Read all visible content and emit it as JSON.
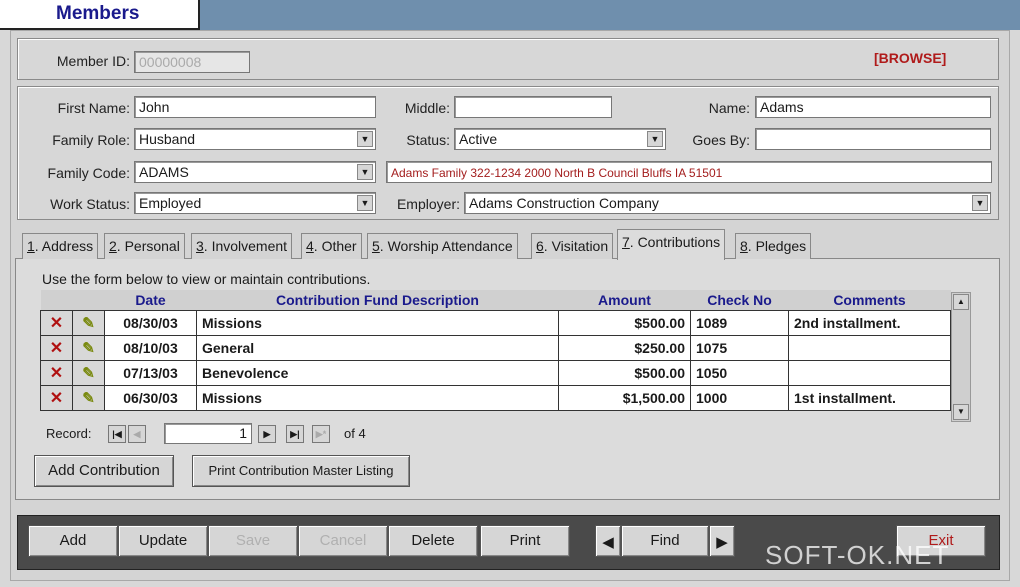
{
  "window": {
    "title": "Members"
  },
  "header": {
    "member_id_label": "Member ID:",
    "member_id_value": "00000008",
    "mode": "[BROWSE]"
  },
  "form": {
    "first_name_label": "First Name:",
    "first_name": "John",
    "middle_label": "Middle:",
    "middle": "",
    "name_label": "Name:",
    "name": "Adams",
    "family_role_label": "Family Role:",
    "family_role": "Husband",
    "status_label": "Status:",
    "status": "Active",
    "goes_by_label": "Goes By:",
    "goes_by": "",
    "family_code_label": "Family Code:",
    "family_code": "ADAMS",
    "family_info": "Adams Family 322-1234 2000 North B Council Bluffs IA 51501",
    "work_status_label": "Work Status:",
    "work_status": "Employed",
    "employer_label": "Employer:",
    "employer": "Adams Construction Company"
  },
  "tabs": [
    {
      "key": "1",
      "label": ". Address"
    },
    {
      "key": "2",
      "label": ". Personal"
    },
    {
      "key": "3",
      "label": ". Involvement"
    },
    {
      "key": "4",
      "label": ". Other"
    },
    {
      "key": "5",
      "label": ". Worship Attendance"
    },
    {
      "key": "6",
      "label": ". Visitation"
    },
    {
      "key": "7",
      "label": ". Contributions"
    },
    {
      "key": "8",
      "label": ". Pledges"
    }
  ],
  "contributions": {
    "instructions": "Use the form below to view or maintain contributions.",
    "columns": [
      "Date",
      "Contribution Fund Description",
      "Amount",
      "Check No",
      "Comments"
    ],
    "rows": [
      {
        "date": "08/30/03",
        "fund": "Missions",
        "amount": "$500.00",
        "check": "1089",
        "comments": "2nd installment."
      },
      {
        "date": "08/10/03",
        "fund": "General",
        "amount": "$250.00",
        "check": "1075",
        "comments": ""
      },
      {
        "date": "07/13/03",
        "fund": "Benevolence",
        "amount": "$500.00",
        "check": "1050",
        "comments": ""
      },
      {
        "date": "06/30/03",
        "fund": "Missions",
        "amount": "$1,500.00",
        "check": "1000",
        "comments": "1st installment."
      }
    ],
    "record_label": "Record:",
    "record_current": "1",
    "record_of": "of",
    "record_total": "4",
    "add_button": "Add Contribution",
    "print_button": "Print Contribution Master Listing"
  },
  "toolbar": {
    "add": "Add",
    "update": "Update",
    "save": "Save",
    "cancel": "Cancel",
    "delete": "Delete",
    "print": "Print",
    "find": "Find",
    "exit": "Exit"
  },
  "watermark": "SOFT-OK.NET",
  "icons": {
    "delete_row": "x-icon",
    "edit_row": "pencil-icon",
    "dropdown": "chevron-down-icon"
  },
  "colors": {
    "title_text": "#1a1a8c",
    "mode_text": "#b01b1b",
    "family_info_text": "#a31d1d",
    "header_band": "#6f8fad"
  }
}
